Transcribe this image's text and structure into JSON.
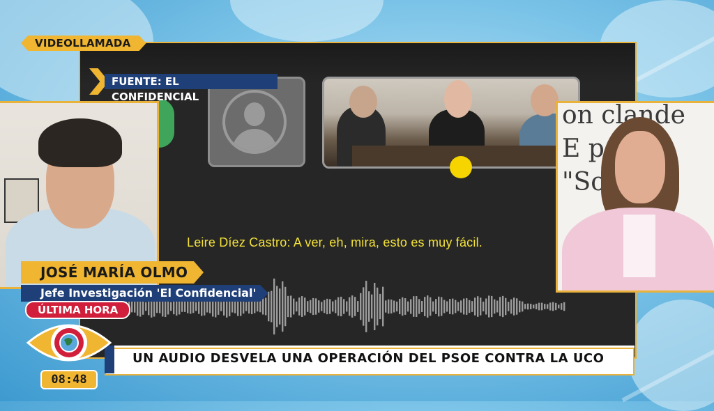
{
  "program": {
    "section_tag": "VIDEOLLAMADA",
    "source_tag": "FUENTE: EL CONFIDENCIAL",
    "breaking_label": "ÚLTIMA HORA",
    "clock": "08:48"
  },
  "call": {
    "subtitle": "Leire Díez Castro: A ver, eh, mira, esto es muy fácil.",
    "placeholder_icon": "user-silhouette-icon",
    "speaking_indicator_color": "#f5d400"
  },
  "guest": {
    "name": "JOSÉ MARÍA OLMO",
    "role": "Jefe Investigación 'El Confidencial'"
  },
  "headline": "UN AUDIO DESVELA UNA OPERACIÓN DEL PSOE CONTRA LA UCO",
  "host_backdrop_text": [
    "on clande",
    "E p  aca",
    "\"So  as c"
  ],
  "colors": {
    "accent_gold": "#f0b632",
    "navy": "#1f3f78",
    "breaking_red": "#d11e3a",
    "subtitle_yellow": "#f3e23a"
  }
}
